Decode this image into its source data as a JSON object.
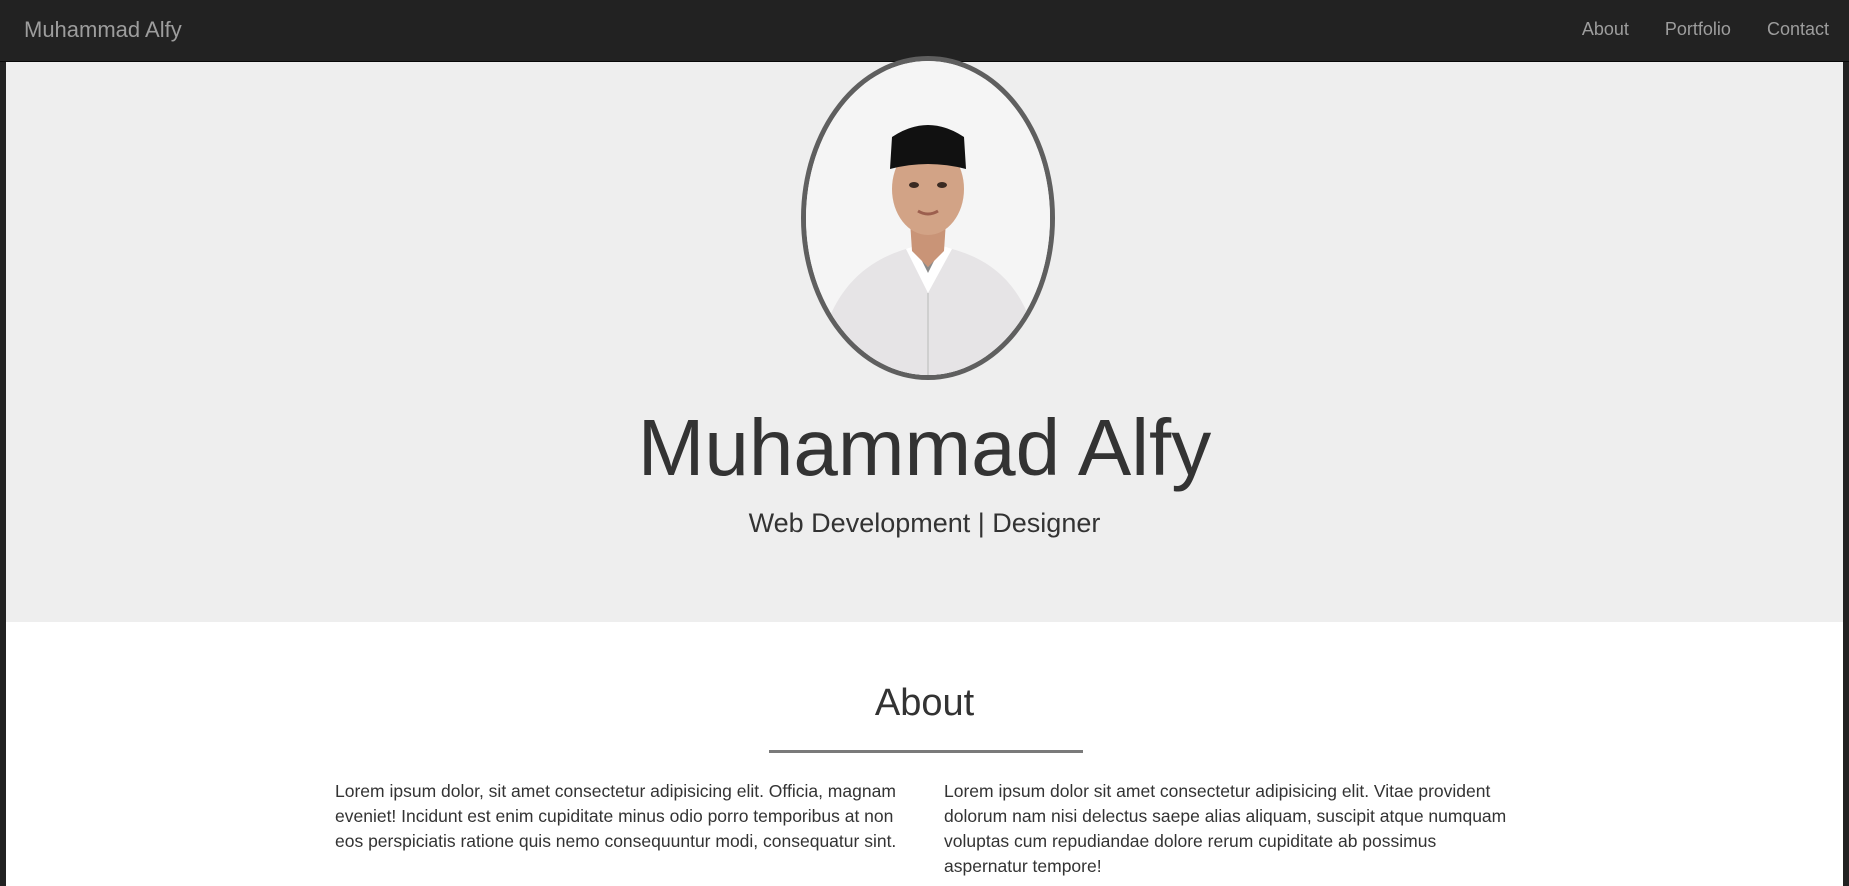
{
  "navbar": {
    "brand": "Muhammad Alfy",
    "links": [
      "About",
      "Portfolio",
      "Contact"
    ]
  },
  "hero": {
    "name": "Muhammad Alfy",
    "subtitle": "Web Development | Designer"
  },
  "about": {
    "title": "About",
    "col1": "Lorem ipsum dolor, sit amet consectetur adipisicing elit. Officia, magnam eveniet! Incidunt est enim cupiditate minus odio porro temporibus at non eos perspiciatis ratione quis nemo consequuntur modi, consequatur sint.",
    "col2": "Lorem ipsum dolor sit amet consectetur adipisicing elit. Vitae provident dolorum nam nisi delectus saepe alias aliquam, suscipit atque numquam voluptas cum repudiandae dolore rerum cupiditate ab possimus aspernatur tempore!"
  },
  "colors": {
    "navbar_bg": "#222222",
    "nav_text": "#9d9d9d",
    "hero_bg": "#eeeeee",
    "text": "#333333",
    "avatar_border": "#5f5f5f"
  },
  "icons": {
    "avatar": "profile-photo"
  }
}
